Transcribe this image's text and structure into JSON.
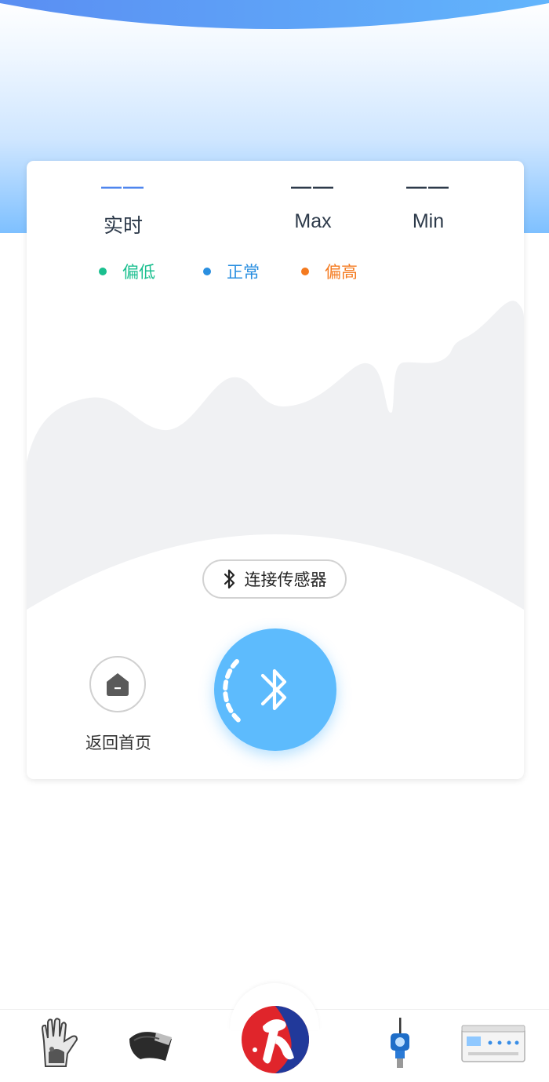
{
  "metrics": {
    "realtime": {
      "value": "——",
      "label": "实时"
    },
    "max": {
      "value": "——",
      "label": "Max"
    },
    "min": {
      "value": "——",
      "label": "Min"
    }
  },
  "legend": [
    {
      "label": "偏低",
      "color": "#1abf8f"
    },
    {
      "label": "正常",
      "color": "#2a8fe0"
    },
    {
      "label": "偏高",
      "color": "#f47a1f"
    }
  ],
  "connect_button": {
    "label": "连接传感器",
    "icon": "bluetooth-icon"
  },
  "home_button": {
    "label": "返回首页",
    "icon": "home-icon"
  },
  "bluetooth_button": {
    "icon": "bluetooth-icon",
    "color": "#5dbbfd"
  },
  "bottom_nav": {
    "items": [
      {
        "name": "glove-device",
        "icon": "glove-icon"
      },
      {
        "name": "wrap-device",
        "icon": "wrap-band-icon"
      },
      {
        "name": "brand-logo",
        "icon": "logo-icon"
      },
      {
        "name": "transmitter-device",
        "icon": "transmitter-icon"
      },
      {
        "name": "console-device",
        "icon": "console-box-icon"
      }
    ]
  },
  "colors": {
    "accent": "#5dbbfd",
    "realtime": "#4f86ee",
    "text": "#2d3a4a"
  }
}
